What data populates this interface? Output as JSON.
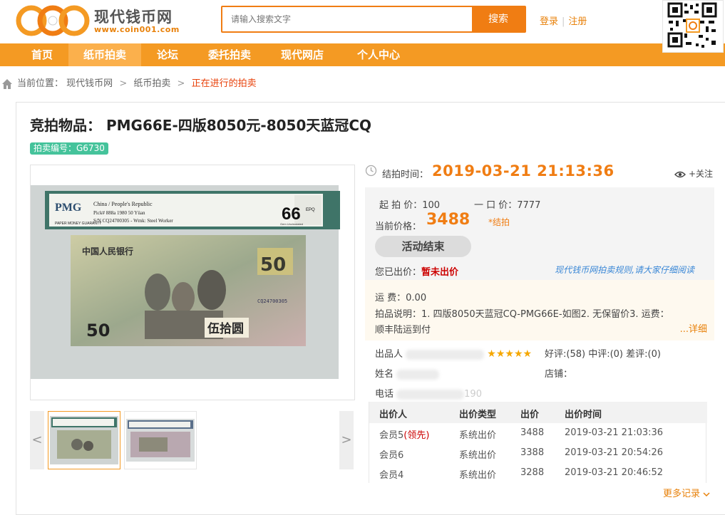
{
  "header": {
    "logo_cn": "现代钱币网",
    "logo_url": "www.coin001.com",
    "search_placeholder": "请输入搜索文字",
    "search_button": "搜索",
    "login": "登录",
    "sep": "|",
    "register": "注册"
  },
  "nav": {
    "items": [
      {
        "label": "首页"
      },
      {
        "label": "纸币拍卖"
      },
      {
        "label": "论坛"
      },
      {
        "label": "委托拍卖"
      },
      {
        "label": "现代网店"
      },
      {
        "label": "个人中心"
      }
    ],
    "active_index": 1
  },
  "breadcrumb": {
    "prefix": "当前位置：",
    "items": [
      "现代钱币网",
      "纸币拍卖",
      "正在进行的拍卖"
    ],
    "arrow": ">"
  },
  "item": {
    "title_label": "竞拍物品：",
    "title": "PMG66E-四版8050元-8050天蓝冠CQ",
    "lot_number": "拍卖编号：G6730"
  },
  "note": {
    "pmg_brand": "PMG",
    "pmg_line1": "China / People's Republic",
    "pmg_line2": "Pick# 888a   1980  50 Yüan",
    "pmg_line3": "S/N CQ24700305 - Wmk: Steel Worker",
    "pmg_small": "PAPER MONEY GUARANTY",
    "grade": "66",
    "grade_suffix": "EPQ",
    "grade_note": "Gem Uncirculated",
    "bank_name": "中国人民银行",
    "denom": "50",
    "denom_cn": "伍拾圆",
    "serial": "CQ24700305"
  },
  "auction": {
    "end_label": "结拍时间：",
    "end_time": "2019-03-21 21:13:36",
    "follow": "+关注",
    "start_price_label": "起 拍 价：",
    "start_price": "100",
    "buyout_label": "一 口 价：",
    "buyout": "7777",
    "current_label": "当前价格：",
    "current_price": "3488",
    "jiepai": "*结拍",
    "status_button": "活动结束",
    "your_bid_label": "您已出价：",
    "your_bid": "暂未出价",
    "rules_link": "现代钱币网拍卖规则,请大家仔细阅读",
    "shipping_label": "运 费：",
    "shipping": "0.00",
    "desc_label": "拍品说明：",
    "desc_line1": "1. 四版8050天蓝冠CQ-PMG66E-如图2. 无保留价3. 运费：",
    "desc_line2": "顺丰陆运到付",
    "detail_link": "...详细"
  },
  "seller": {
    "seller_label": "出品人",
    "rating": "好评:(58) 中评:(0) 差评:(0)",
    "name_label": "姓名",
    "shop_label": "店铺：",
    "phone_label": "电话",
    "phone_tail": "190"
  },
  "bids": {
    "headers": [
      "出价人",
      "出价类型",
      "出价",
      "出价时间"
    ],
    "rows": [
      {
        "bidder": "会员5",
        "lead": "(领先)",
        "type": "系统出价",
        "price": "3488",
        "time": "2019-03-21 21:03:36"
      },
      {
        "bidder": "会员6",
        "lead": "",
        "type": "系统出价",
        "price": "3388",
        "time": "2019-03-21 20:54:26"
      },
      {
        "bidder": "会员4",
        "lead": "",
        "type": "系统出价",
        "price": "3288",
        "time": "2019-03-21 20:46:52"
      }
    ],
    "more": "更多记录"
  },
  "thumbs": {
    "prev": "<",
    "next": ">"
  },
  "colors": {
    "accent": "#f07d13",
    "nav": "#f49a23",
    "nav_active": "#fbb04c",
    "lot_badge": "#45c39b",
    "link_blue": "#3a87d6",
    "warn_red": "#cc0000"
  }
}
